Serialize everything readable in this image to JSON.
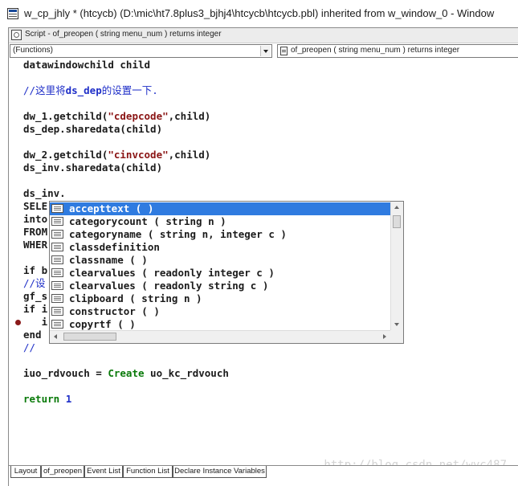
{
  "window": {
    "title": "w_cp_jhly * (htcycb) (D:\\mic\\ht7.8plus3_bjhj4\\htcycb\\htcycb.pbl) inherited from w_window_0 - Window"
  },
  "script": {
    "title": "Script - of_preopen ( string menu_num ) returns integer",
    "object_combo": "(Functions)",
    "event_combo": "of_preopen ( string menu_num ) returns integer"
  },
  "code_lines": [
    "datawindowchild child",
    "",
    "//这里将ds_dep的设置一下.",
    "",
    "dw_1.getchild(\"cdepcode\",child)",
    "ds_dep.sharedata(child)",
    "",
    "dw_2.getchild(\"cinvcode\",child)",
    "ds_inv.sharedata(child)",
    "",
    "ds_inv.",
    "SELE",
    "into",
    "FROM",
    "WHER",
    "",
    "if b",
    "//设",
    "gf_s",
    "if i",
    "   i",
    "end",
    "//",
    "",
    "iuo_rdvouch = Create uo_kc_rdvouch",
    "",
    "return 1"
  ],
  "code_tokens": {
    "comment_prefix": "//",
    "comment_text": "这里将",
    "comment_var": "ds_dep",
    "comment_suffix": "的设置一下.",
    "getchild1_prefix": "dw_1.getchild(",
    "getchild1_string": "\"cdepcode\"",
    "getchild1_suffix": ",child)",
    "getchild2_prefix": "dw_2.getchild(",
    "getchild2_string": "\"cinvcode\"",
    "getchild2_suffix": ",child)",
    "create_prefix": "iuo_rdvouch = ",
    "create_keyword": "Create",
    "create_suffix": " uo_kc_rdvouch",
    "return_keyword": "return ",
    "return_value": "1",
    "comment_short": "//设"
  },
  "autocomplete": {
    "items": [
      {
        "label": "accepttext ( )",
        "selected": true
      },
      {
        "label": "categorycount ( string n )",
        "selected": false
      },
      {
        "label": "categoryname ( string n, integer c )",
        "selected": false
      },
      {
        "label": "classdefinition",
        "selected": false
      },
      {
        "label": "classname ( )",
        "selected": false
      },
      {
        "label": "clearvalues ( readonly integer c )",
        "selected": false
      },
      {
        "label": "clearvalues ( readonly string c )",
        "selected": false
      },
      {
        "label": "clipboard ( string n )",
        "selected": false
      },
      {
        "label": "constructor ( )",
        "selected": false
      },
      {
        "label": "copyrtf ( )",
        "selected": false
      }
    ]
  },
  "tabs": [
    {
      "label": "Layout",
      "active": false
    },
    {
      "label": "of_preopen",
      "active": true
    },
    {
      "label": "Event List",
      "active": false
    },
    {
      "label": "Function List",
      "active": false
    },
    {
      "label": "Declare Instance Variables",
      "active": false
    }
  ],
  "watermark": "http://blog.csdn.net/wyc487",
  "colors": {
    "selection": "#2f7be0",
    "comment": "#1f2fc8",
    "string": "#8a1414",
    "keyword": "#0a7a0a",
    "breakpoint": "#8a1a1a"
  },
  "icons": {
    "app": "window-icon",
    "script": "script-icon",
    "function": "function-icon",
    "autocomplete_item": "function-list-icon",
    "breakpoint": "breakpoint-marker"
  }
}
